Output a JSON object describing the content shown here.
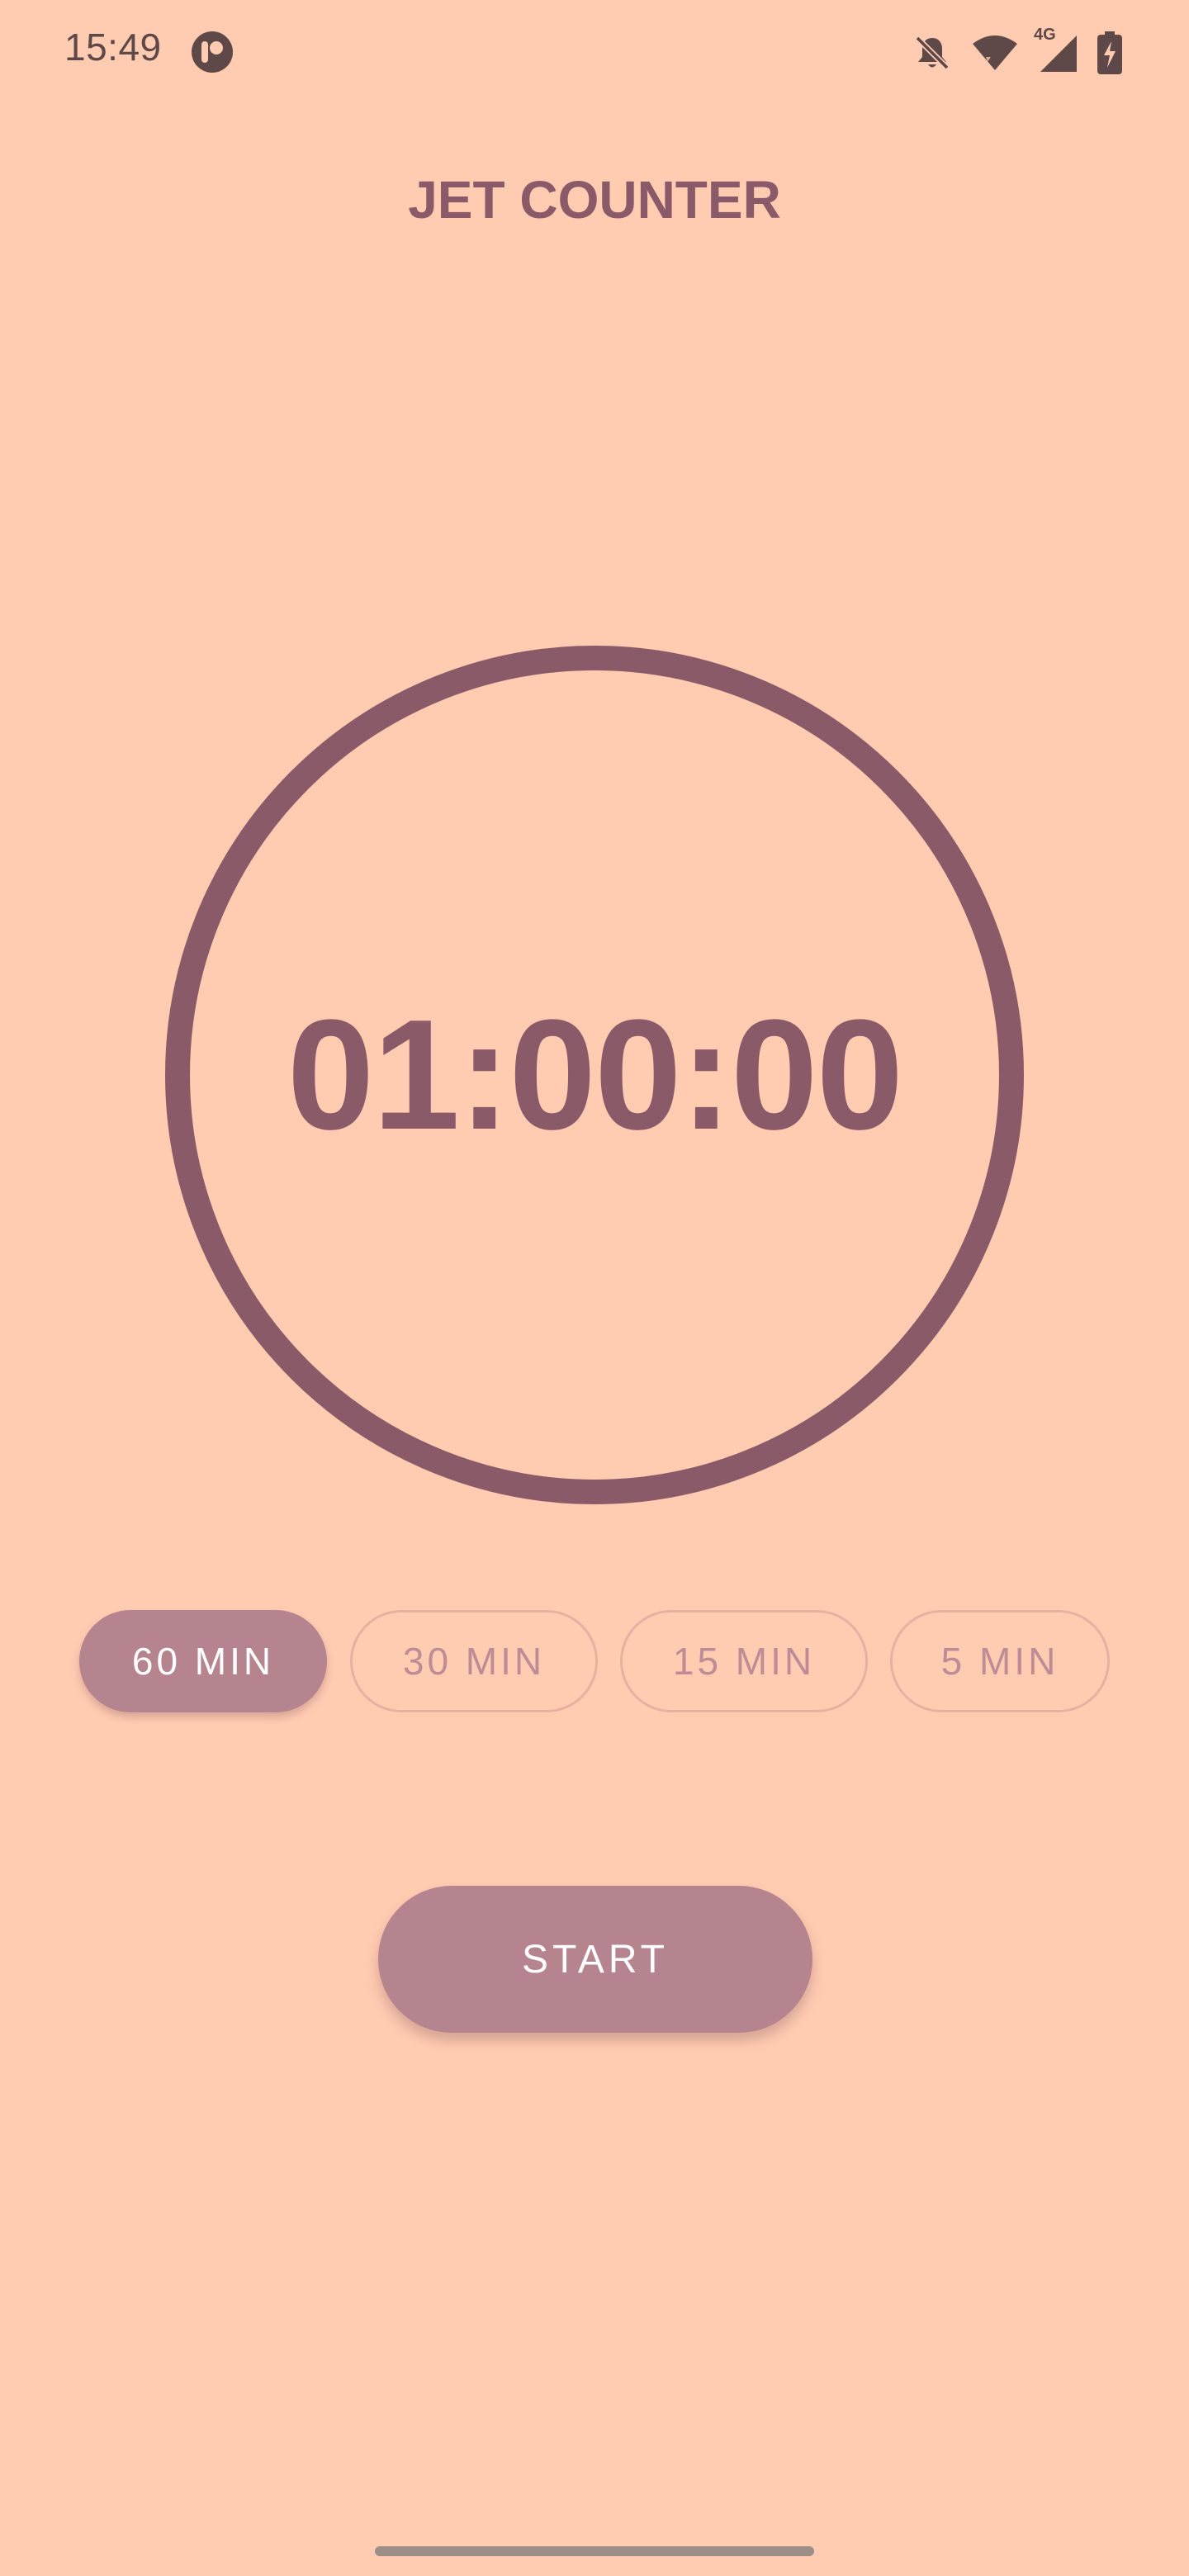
{
  "status_bar": {
    "time": "15:49",
    "network_label": "4G",
    "icons": [
      "app-notification-icon",
      "notifications-off-icon",
      "wifi-icon",
      "cellular-signal-icon",
      "battery-charging-icon"
    ]
  },
  "header": {
    "title": "JET COUNTER"
  },
  "timer": {
    "display": "01:00:00"
  },
  "durations": [
    {
      "label": "60 MIN",
      "selected": true
    },
    {
      "label": "30 MIN",
      "selected": false
    },
    {
      "label": "15 MIN",
      "selected": false
    },
    {
      "label": "5 MIN",
      "selected": false
    }
  ],
  "actions": {
    "start_label": "START"
  },
  "colors": {
    "background": "#FFCCB2",
    "primary": "#8B5A69",
    "accent": "#B6848F",
    "chip_border": "#E7B0A1",
    "chip_text": "#BE8C95"
  }
}
